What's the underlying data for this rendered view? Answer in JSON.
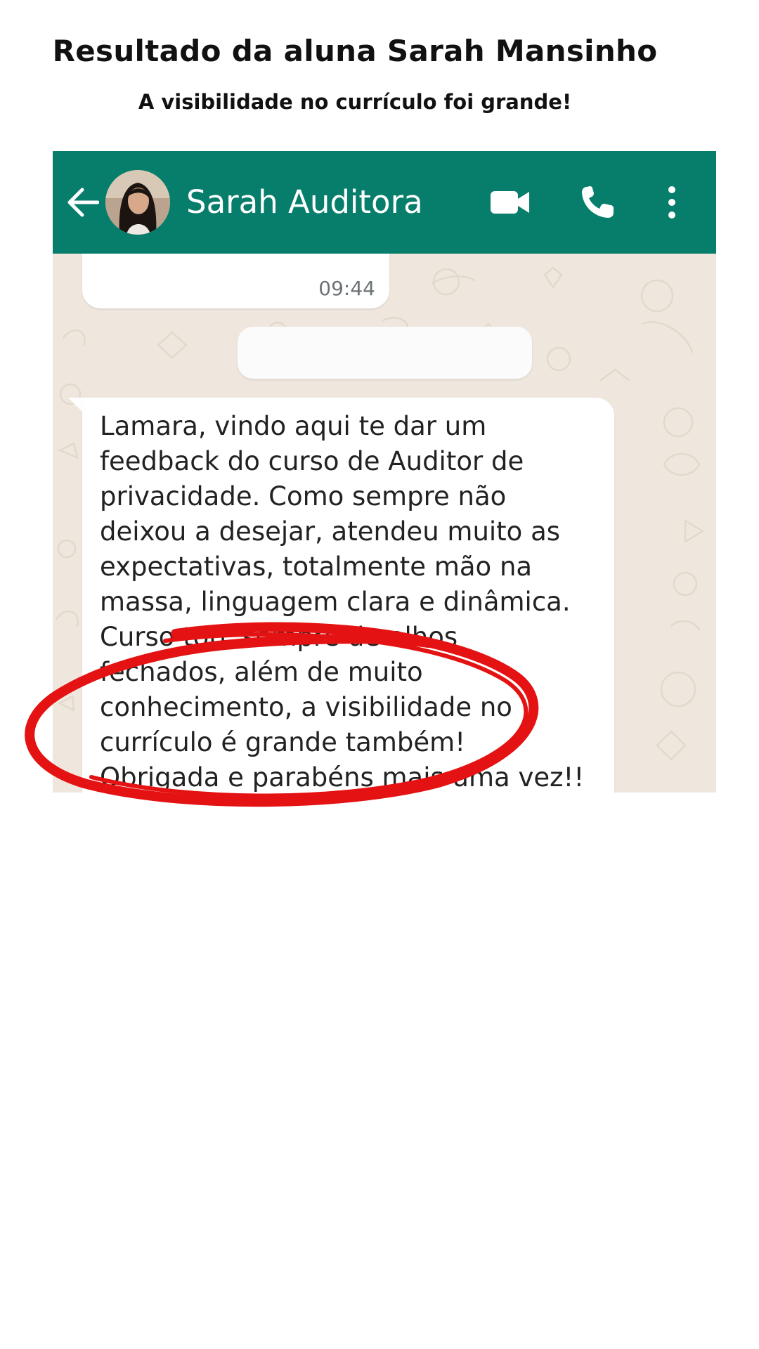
{
  "page": {
    "title": "Resultado da aluna Sarah Mansinho",
    "subtitle": "A visibilidade no currículo foi grande!"
  },
  "header": {
    "contact_name": "Sarah Auditora",
    "icons": [
      "back-arrow-icon",
      "avatar",
      "video-call-icon",
      "phone-call-icon",
      "more-options-icon"
    ],
    "background_color": "#077e6c"
  },
  "chat": {
    "previous_message_time": "09:44",
    "message_text": "Lamara, vindo aqui te dar um\nfeedback do curso de Auditor de\nprivacidade. Como sempre não\ndeixou a desejar, atendeu muito as\nexpectativas, totalmente mão na\nmassa, linguagem clara e dinâmica.\nCurso top, sempre de olhos\nfechados, além de muito\nconhecimento, a visibilidade no\ncurrículo é grande também!\nObrigada e parabéns mais uma vez!!",
    "wallpaper_color": "#efe7de"
  },
  "highlight": {
    "color": "#e41212"
  }
}
